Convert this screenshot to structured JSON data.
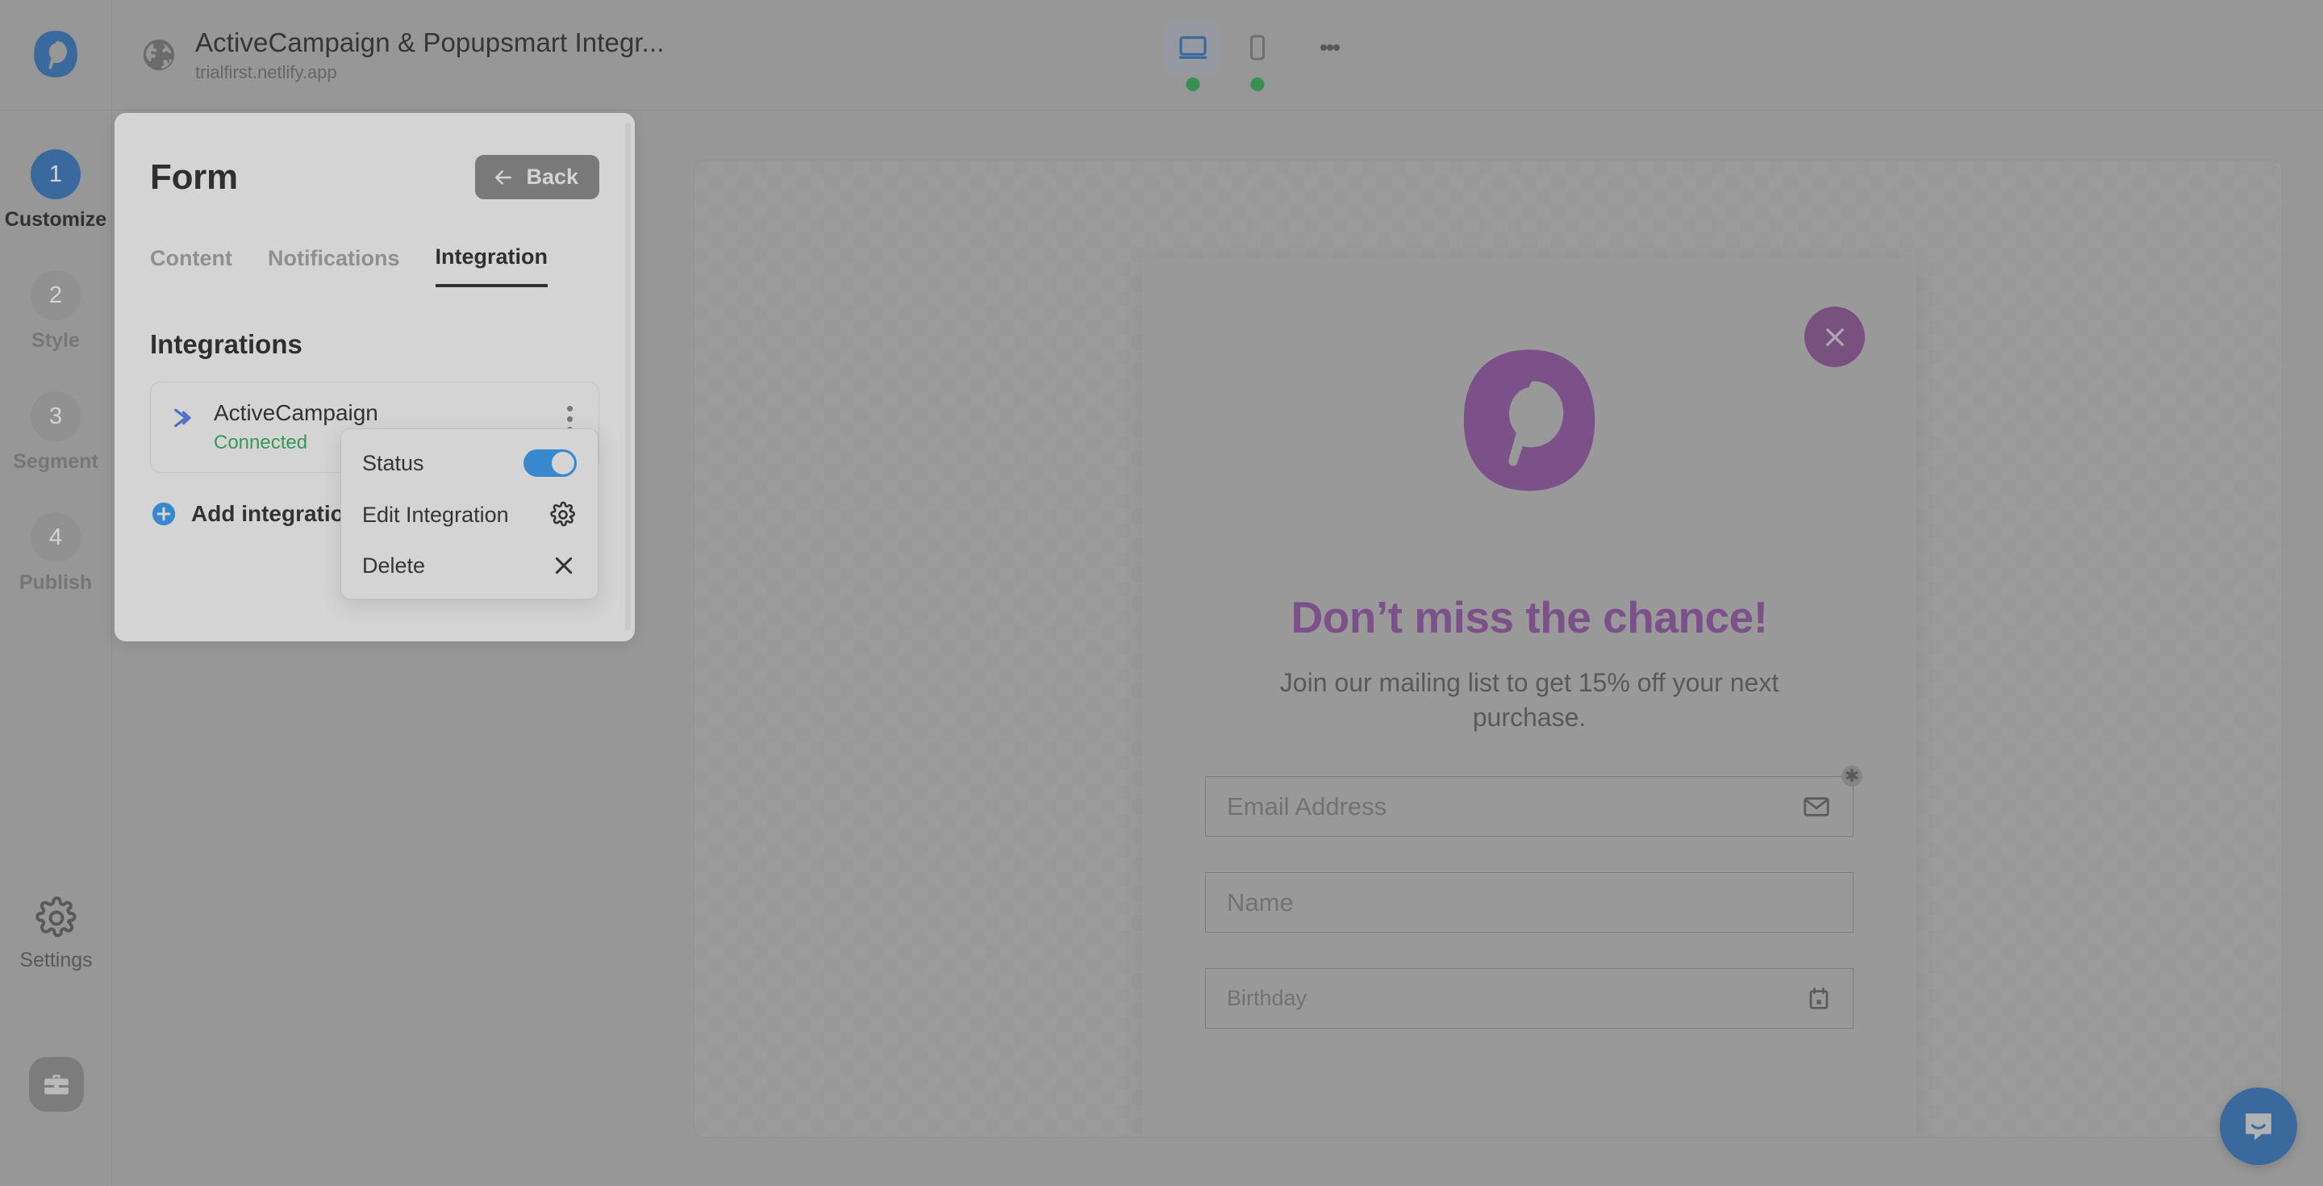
{
  "brand": {
    "logo_icon": "popupsmart-logo",
    "logo_color": "#1b62ae"
  },
  "topbar": {
    "globe_icon": "globe-icon",
    "site_title": "ActiveCampaign & Popupsmart Integr...",
    "site_url": "trialfirst.netlify.app",
    "devices": [
      {
        "name": "desktop",
        "icon": "desktop-icon",
        "active": true,
        "status_dot": "#189b3e"
      },
      {
        "name": "mobile",
        "icon": "mobile-icon",
        "active": false,
        "status_dot": "#189b3e"
      }
    ],
    "more_icon": "kebab-menu-icon"
  },
  "rail": {
    "steps": [
      {
        "number": "1",
        "label": "Customize",
        "active": true
      },
      {
        "number": "2",
        "label": "Style",
        "active": false
      },
      {
        "number": "3",
        "label": "Segment",
        "active": false
      },
      {
        "number": "4",
        "label": "Publish",
        "active": false
      }
    ],
    "settings": {
      "label": "Settings",
      "icon": "gear-icon"
    },
    "briefcase": {
      "icon": "briefcase-icon"
    },
    "active_color": "#1b62ae"
  },
  "panel": {
    "title": "Form",
    "back_label": "Back",
    "back_icon": "arrow-left-icon",
    "tabs": [
      {
        "label": "Content",
        "active": false
      },
      {
        "label": "Notifications",
        "active": false
      },
      {
        "label": "Integration",
        "active": true
      }
    ],
    "section_title": "Integrations",
    "integrations": [
      {
        "name": "ActiveCampaign",
        "status": "Connected",
        "status_color": "#1aa845",
        "logo_icon": "activecampaign-icon",
        "menu_icon": "kebab-menu-icon"
      }
    ],
    "add_integration": {
      "label": "Add integration",
      "icon": "plus-circle-icon",
      "color": "#1a90f5"
    }
  },
  "context_menu": {
    "items": [
      {
        "label": "Status",
        "control": "toggle",
        "toggle_on": true,
        "toggle_color": "#1a90f5"
      },
      {
        "label": "Edit Integration",
        "control": "icon",
        "icon": "gear-icon"
      },
      {
        "label": "Delete",
        "control": "icon",
        "icon": "close-x-icon"
      }
    ]
  },
  "preview": {
    "close_icon": "close-x-icon",
    "close_color": "#7a3f82",
    "logo_icon": "popupsmart-logo",
    "logo_color": "#7e3f92",
    "heading": "Don’t miss the chance!",
    "heading_color": "#7e3f92",
    "subtext": "Join our mailing list to get 15% off your next purchase.",
    "fields": [
      {
        "placeholder": "Email Address",
        "icon": "envelope-icon",
        "required_badge": "✱"
      },
      {
        "placeholder": "Name",
        "icon": ""
      },
      {
        "placeholder": "Birthday",
        "icon": "calendar-icon"
      }
    ]
  },
  "chat": {
    "icon": "chat-bubble-icon",
    "color": "#1b62ae"
  }
}
